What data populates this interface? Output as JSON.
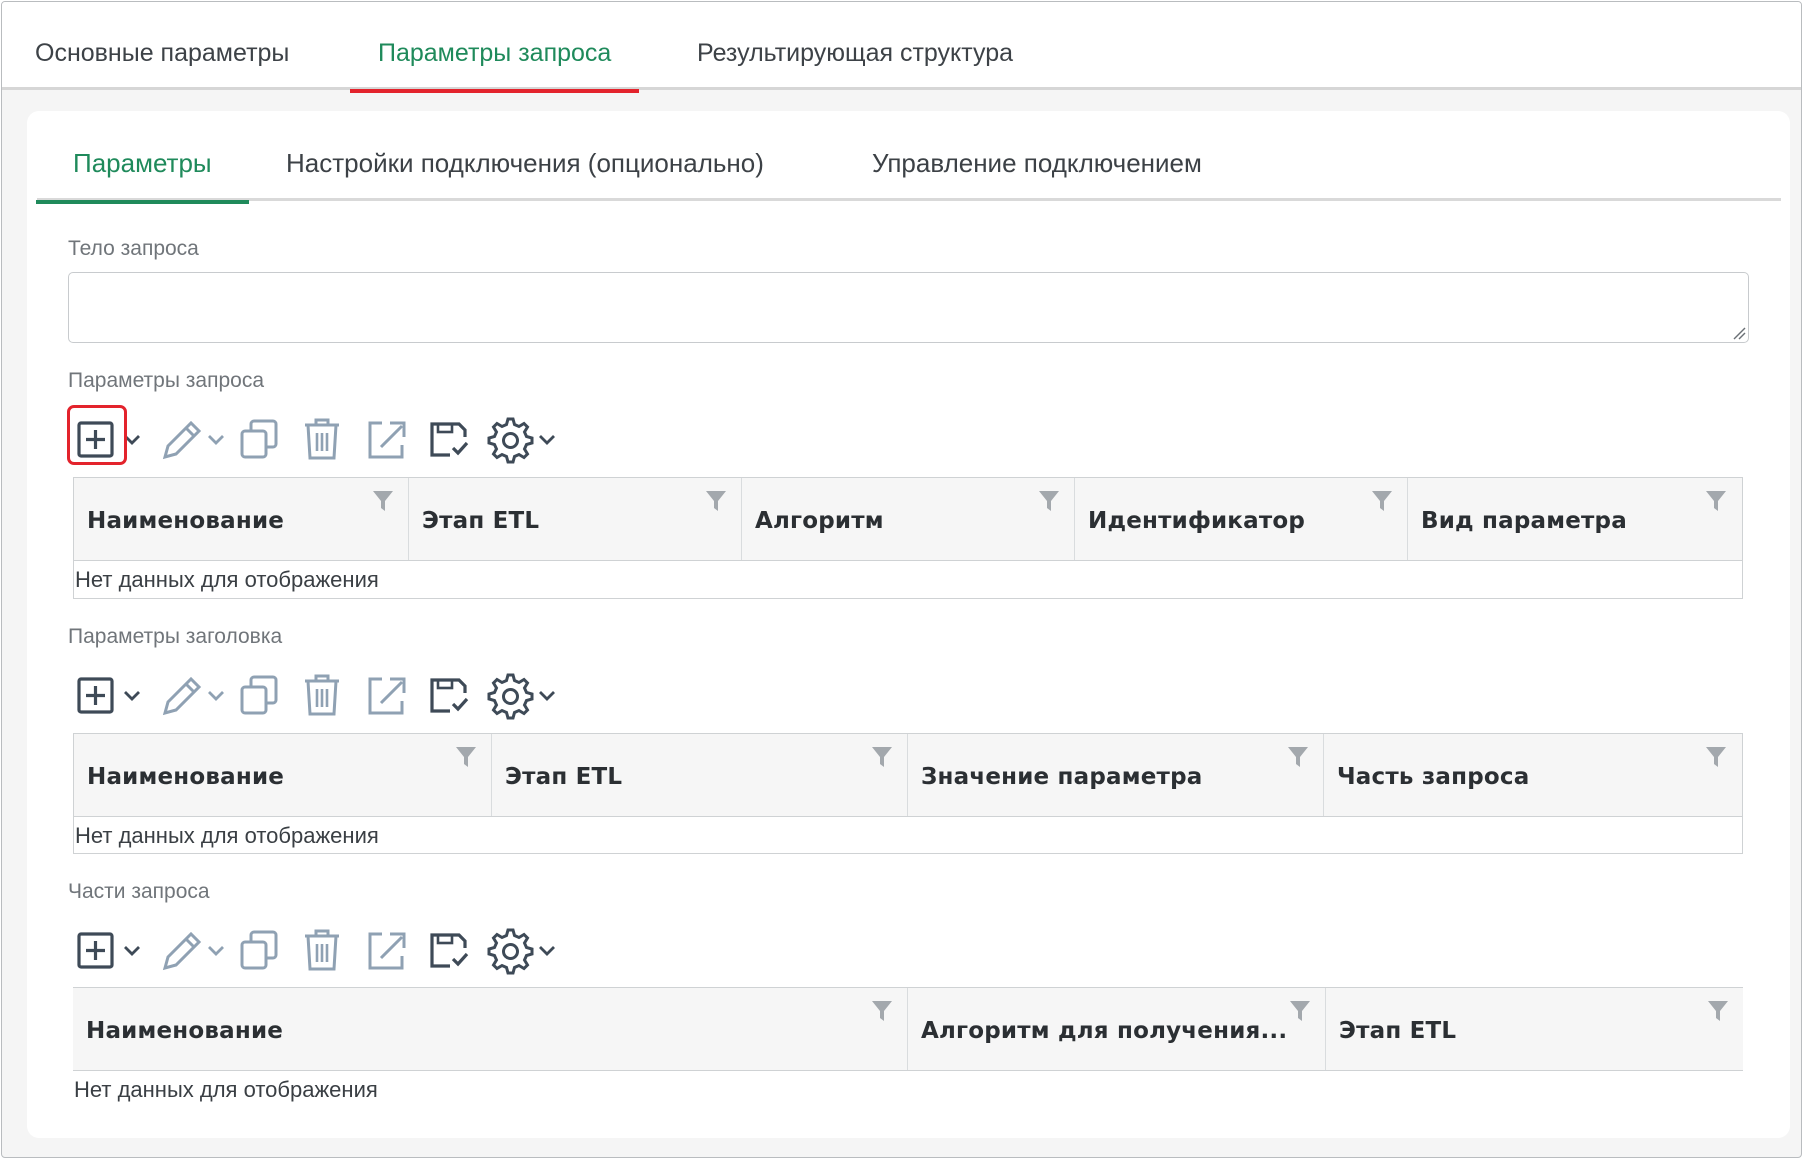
{
  "top_tabs": [
    {
      "label": "Основные параметры",
      "active": false
    },
    {
      "label": "Параметры запроса",
      "active": true
    },
    {
      "label": "Результирующая структура",
      "active": false
    }
  ],
  "sub_tabs": [
    {
      "label": "Параметры",
      "active": true
    },
    {
      "label": "Настройки подключения (опционально)",
      "active": false
    },
    {
      "label": "Управление подключением",
      "active": false
    }
  ],
  "request_body": {
    "label": "Тело запроса",
    "value": ""
  },
  "toolbar_icons": [
    "add-icon",
    "chevron-down-icon",
    "edit-icon",
    "copy-icon",
    "delete-icon",
    "export-icon",
    "save-check-icon",
    "settings-icon"
  ],
  "sections": [
    {
      "label": "Параметры запроса",
      "add_highlighted": true,
      "columns": [
        "Наименование",
        "Этап ETL",
        "Алгоритм",
        "Идентификатор",
        "Вид параметра"
      ],
      "empty_text": "Нет данных для отображения"
    },
    {
      "label": "Параметры заголовка",
      "add_highlighted": false,
      "columns": [
        "Наименование",
        "Этап ETL",
        "Значение параметра",
        "Часть запроса"
      ],
      "empty_text": "Нет данных для отображения"
    },
    {
      "label": "Части запроса",
      "add_highlighted": false,
      "columns": [
        "Наименование",
        "Алгоритм для получения...",
        "Этап ETL"
      ],
      "empty_text": "Нет данных для отображения"
    }
  ],
  "colors": {
    "active_tab": "#1f8a5b",
    "top_tab_underline": "#e3232c",
    "highlight": "#e3232c",
    "icon_dark": "#3e4a57",
    "icon_light": "#8fa1b3"
  }
}
